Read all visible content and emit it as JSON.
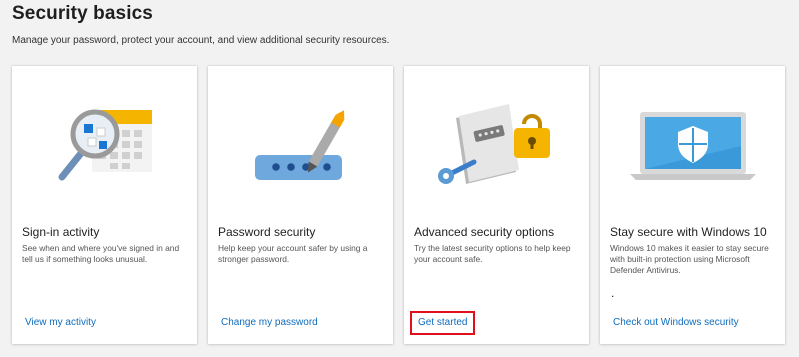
{
  "page": {
    "title": "Security basics",
    "subtitle": "Manage your password, protect your account, and view additional security resources."
  },
  "cards": [
    {
      "title": "Sign-in activity",
      "description": "See when and where you've signed in and tell us if something looks unusual.",
      "link": "View my activity",
      "icon": "calendar-magnifier-icon"
    },
    {
      "title": "Password security",
      "description": "Help keep your account safer by using a stronger password.",
      "link": "Change my password",
      "icon": "password-pen-icon"
    },
    {
      "title": "Advanced security options",
      "description": "Try the latest security options to help keep your account safe.",
      "link": "Get started",
      "icon": "key-lock-icon"
    },
    {
      "title": "Stay secure with Windows 10",
      "description": "Windows 10 makes it easier to stay secure with built-in protection using Microsoft Defender Antivirus.",
      "dot": ".",
      "link": "Check out Windows security",
      "icon": "laptop-shield-icon"
    }
  ],
  "colors": {
    "link": "#0f6cbd",
    "highlight_box": "#e0101c",
    "background": "#f2f2f2"
  }
}
